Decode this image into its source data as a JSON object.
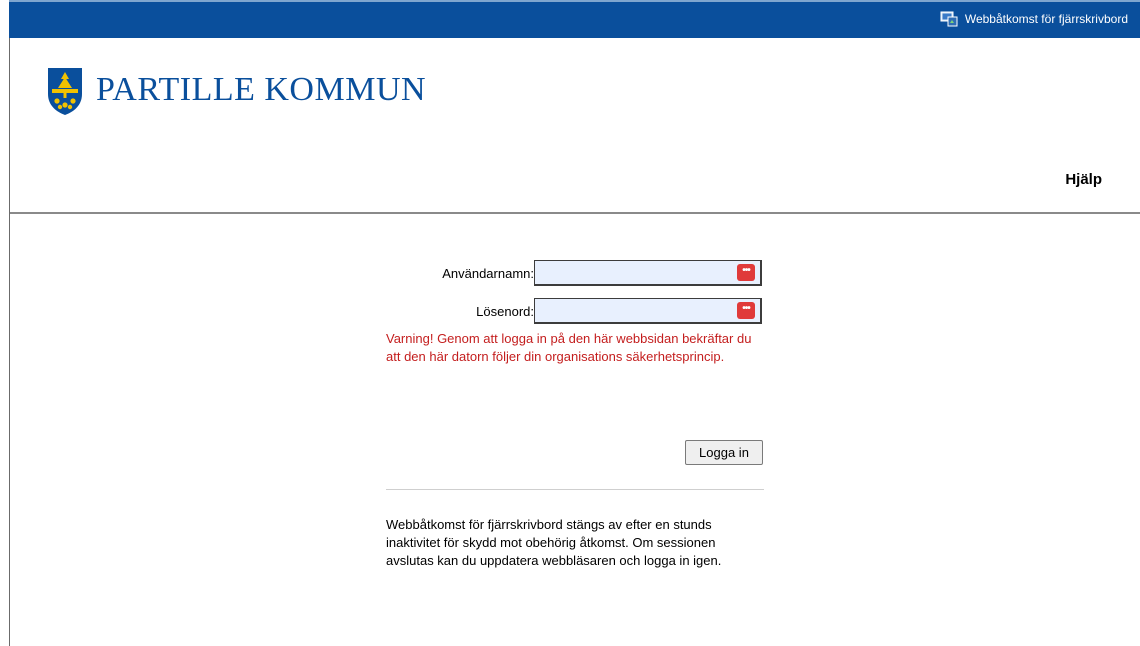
{
  "topbar": {
    "title": "Webbåtkomst för fjärrskrivbord",
    "icon": "remote-desktop-icon"
  },
  "header": {
    "logo_text": "PARTILLE KOMMUN",
    "logo_icon": "coat-of-arms-icon",
    "help_label": "Hjälp"
  },
  "form": {
    "username_label": "Användarnamn:",
    "username_value": "",
    "password_label": "Lösenord:",
    "password_value": "",
    "autofill_badge": "•••",
    "warning": "Varning! Genom att logga in på den här webbsidan bekräftar du att den här datorn följer din organisations säkerhetsprincip.",
    "login_label": "Logga in"
  },
  "info_text": "Webbåtkomst för fjärrskrivbord stängs av efter en stunds inaktivitet för skydd mot obehörig åtkomst. Om sessionen avslutas kan du uppdatera webbläsaren och logga in igen.",
  "colors": {
    "topbar": "#0a4f9c",
    "brand_text": "#0a4f9c",
    "warning_text": "#c41e1e",
    "input_bg": "#e8f0fe",
    "badge": "#e03a3a",
    "logo_gold": "#f2c200"
  }
}
